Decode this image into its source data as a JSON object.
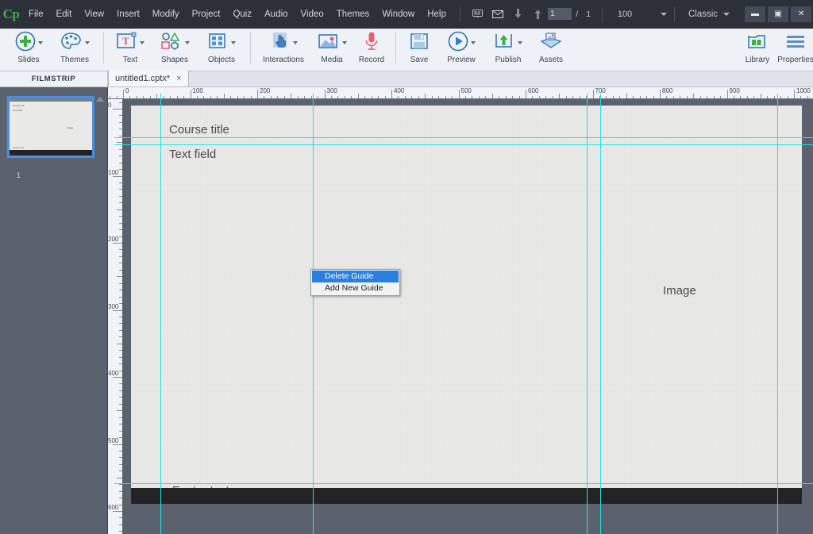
{
  "app": {
    "logo": "Cp",
    "workspace": "Classic",
    "window_controls": [
      "minimize",
      "restore",
      "close"
    ]
  },
  "menubar": {
    "items": [
      {
        "label": "File"
      },
      {
        "label": "Edit"
      },
      {
        "label": "View"
      },
      {
        "label": "Insert"
      },
      {
        "label": "Modify"
      },
      {
        "label": "Project"
      },
      {
        "label": "Quiz"
      },
      {
        "label": "Audio"
      },
      {
        "label": "Video"
      },
      {
        "label": "Themes"
      },
      {
        "label": "Window"
      },
      {
        "label": "Help"
      }
    ],
    "tools": [
      {
        "name": "closed-caption-icon",
        "glyph": "⌸"
      },
      {
        "name": "email-icon",
        "glyph": "✉"
      },
      {
        "name": "arrow-down-icon",
        "glyph": "↓"
      },
      {
        "name": "arrow-up-icon",
        "glyph": "↑"
      }
    ],
    "page_current": "1",
    "page_separator": "/",
    "page_total": "1",
    "zoom_level": "100"
  },
  "ribbon": {
    "groups": [
      {
        "items": [
          {
            "label": "Slides",
            "icon": "add-slide-icon",
            "caret": true
          },
          {
            "label": "Themes",
            "icon": "palette-icon",
            "caret": true
          }
        ]
      },
      {
        "items": [
          {
            "label": "Text",
            "icon": "text-box-icon",
            "caret": true
          },
          {
            "label": "Shapes",
            "icon": "shapes-icon",
            "caret": true
          },
          {
            "label": "Objects",
            "icon": "objects-grid-icon",
            "caret": true
          }
        ]
      },
      {
        "items": [
          {
            "label": "Interactions",
            "icon": "hand-pointer-icon",
            "caret": true
          },
          {
            "label": "Media",
            "icon": "media-image-icon",
            "caret": true
          },
          {
            "label": "Record",
            "icon": "microphone-icon",
            "caret": false
          }
        ]
      },
      {
        "items": [
          {
            "label": "Save",
            "icon": "floppy-disk-icon",
            "caret": false
          },
          {
            "label": "Preview",
            "icon": "play-circle-icon",
            "caret": true
          },
          {
            "label": "Publish",
            "icon": "publish-upload-icon",
            "caret": true
          },
          {
            "label": "Assets",
            "icon": "assets-box-icon",
            "caret": false
          }
        ]
      },
      {
        "items": [
          {
            "label": "Library",
            "icon": "library-book-icon",
            "caret": false
          },
          {
            "label": "Properties",
            "icon": "hamburger-menu-icon",
            "caret": false
          }
        ]
      }
    ]
  },
  "filmstrip": {
    "title": "FILMSTRIP",
    "slides": [
      {
        "number": "1",
        "texts": [
          "Course title",
          "Text field",
          "Image",
          "Footer text"
        ]
      }
    ]
  },
  "document_tab": {
    "name": "untitled1.cptx*",
    "close_glyph": "×"
  },
  "rulers": {
    "horizontal_labels": [
      "0",
      "100",
      "200",
      "300",
      "400",
      "500",
      "600",
      "700",
      "800",
      "900",
      "1000"
    ],
    "vertical_labels": [
      "0",
      "100",
      "200",
      "300",
      "400",
      "500",
      "600"
    ],
    "unit": "px"
  },
  "canvas": {
    "objects": [
      {
        "name": "course-title-text",
        "text": "Course title"
      },
      {
        "name": "text-field-text",
        "text": "Text field"
      },
      {
        "name": "image-placeholder-text",
        "text": "Image"
      },
      {
        "name": "footer-text",
        "text": "Footer text"
      }
    ],
    "guide_color": "#28e0e0",
    "background": "#e9e9e7"
  },
  "context_menu": {
    "items": [
      {
        "label": "Delete Guide",
        "selected": true
      },
      {
        "label": "Add New Guide",
        "selected": false
      }
    ]
  },
  "colors": {
    "menubar_bg": "#2b3039",
    "ribbon_bg": "#eef2f7",
    "stage_bg": "#5c626d",
    "accent_selection": "#2b7fe0",
    "guide": "#28e0e0",
    "logo_green": "#3fae49"
  }
}
